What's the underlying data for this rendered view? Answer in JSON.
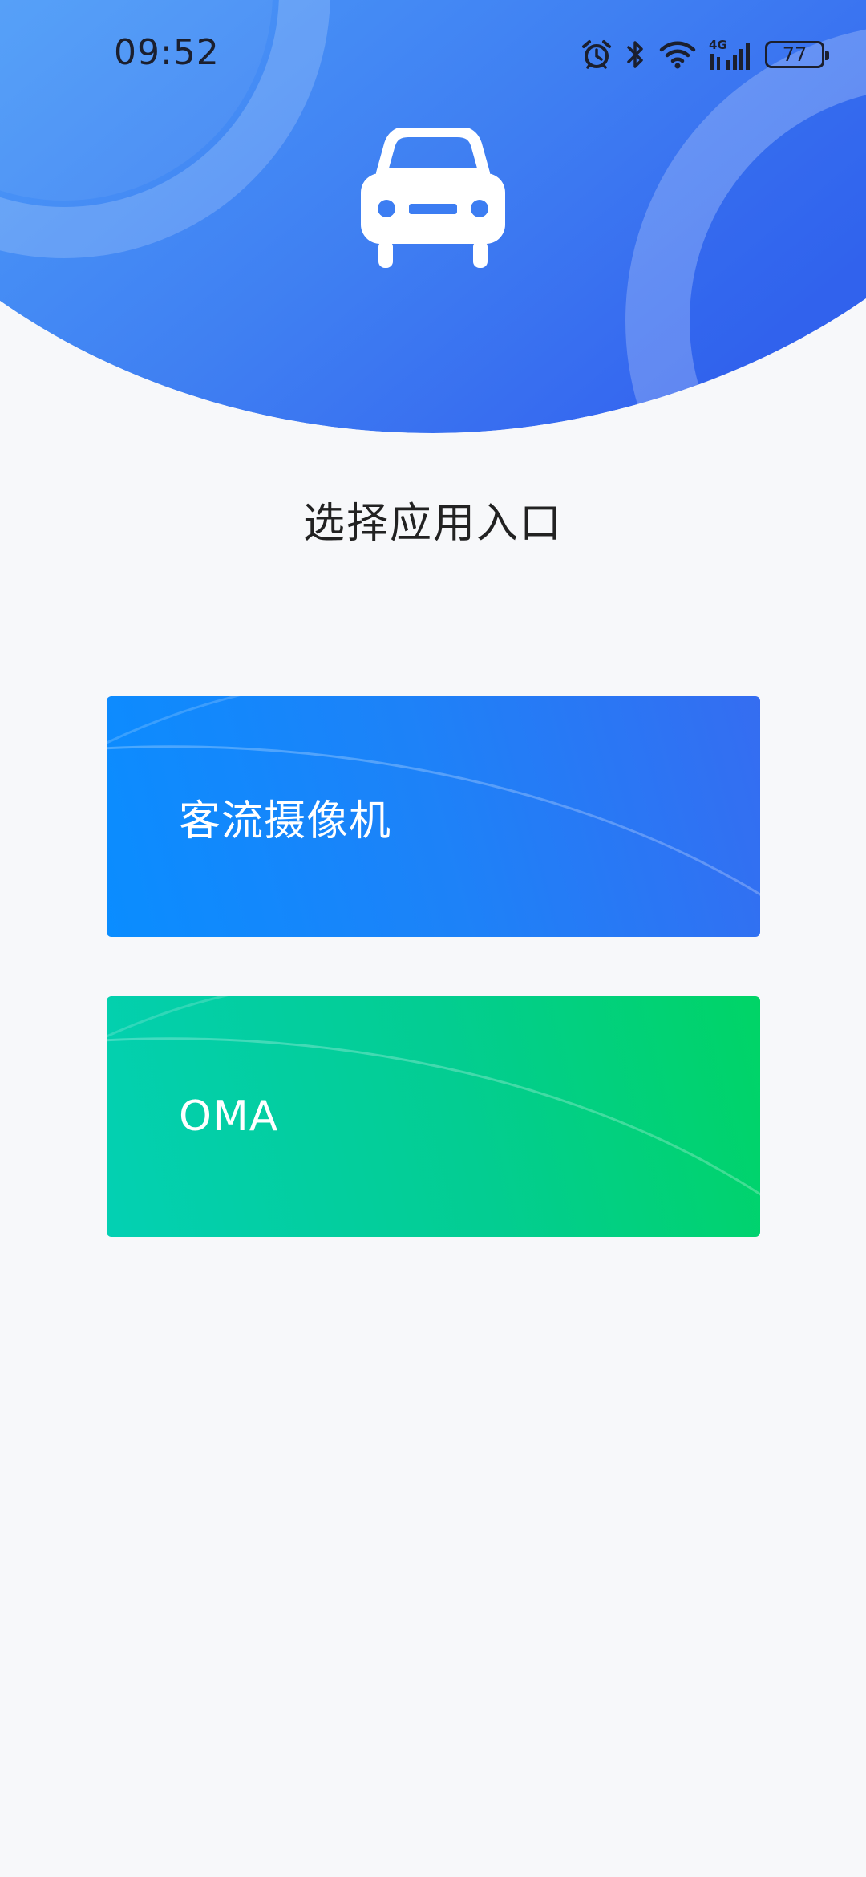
{
  "status_bar": {
    "time": "09:52",
    "network": "4G",
    "battery_level": "77",
    "icons": [
      "alarm-icon",
      "bluetooth-icon",
      "wifi-icon",
      "signal-4g-icon",
      "battery-icon"
    ]
  },
  "header": {
    "logo_icon": "car-icon",
    "gradient_colors": [
      "#4d9af7",
      "#3669f0"
    ]
  },
  "main": {
    "title": "选择应用入口",
    "entries": [
      {
        "label": "客流摄像机",
        "colors": [
          "#0a8dff",
          "#356df1"
        ]
      },
      {
        "label": "OMA",
        "colors": [
          "#03d0b3",
          "#00d466"
        ]
      }
    ]
  }
}
